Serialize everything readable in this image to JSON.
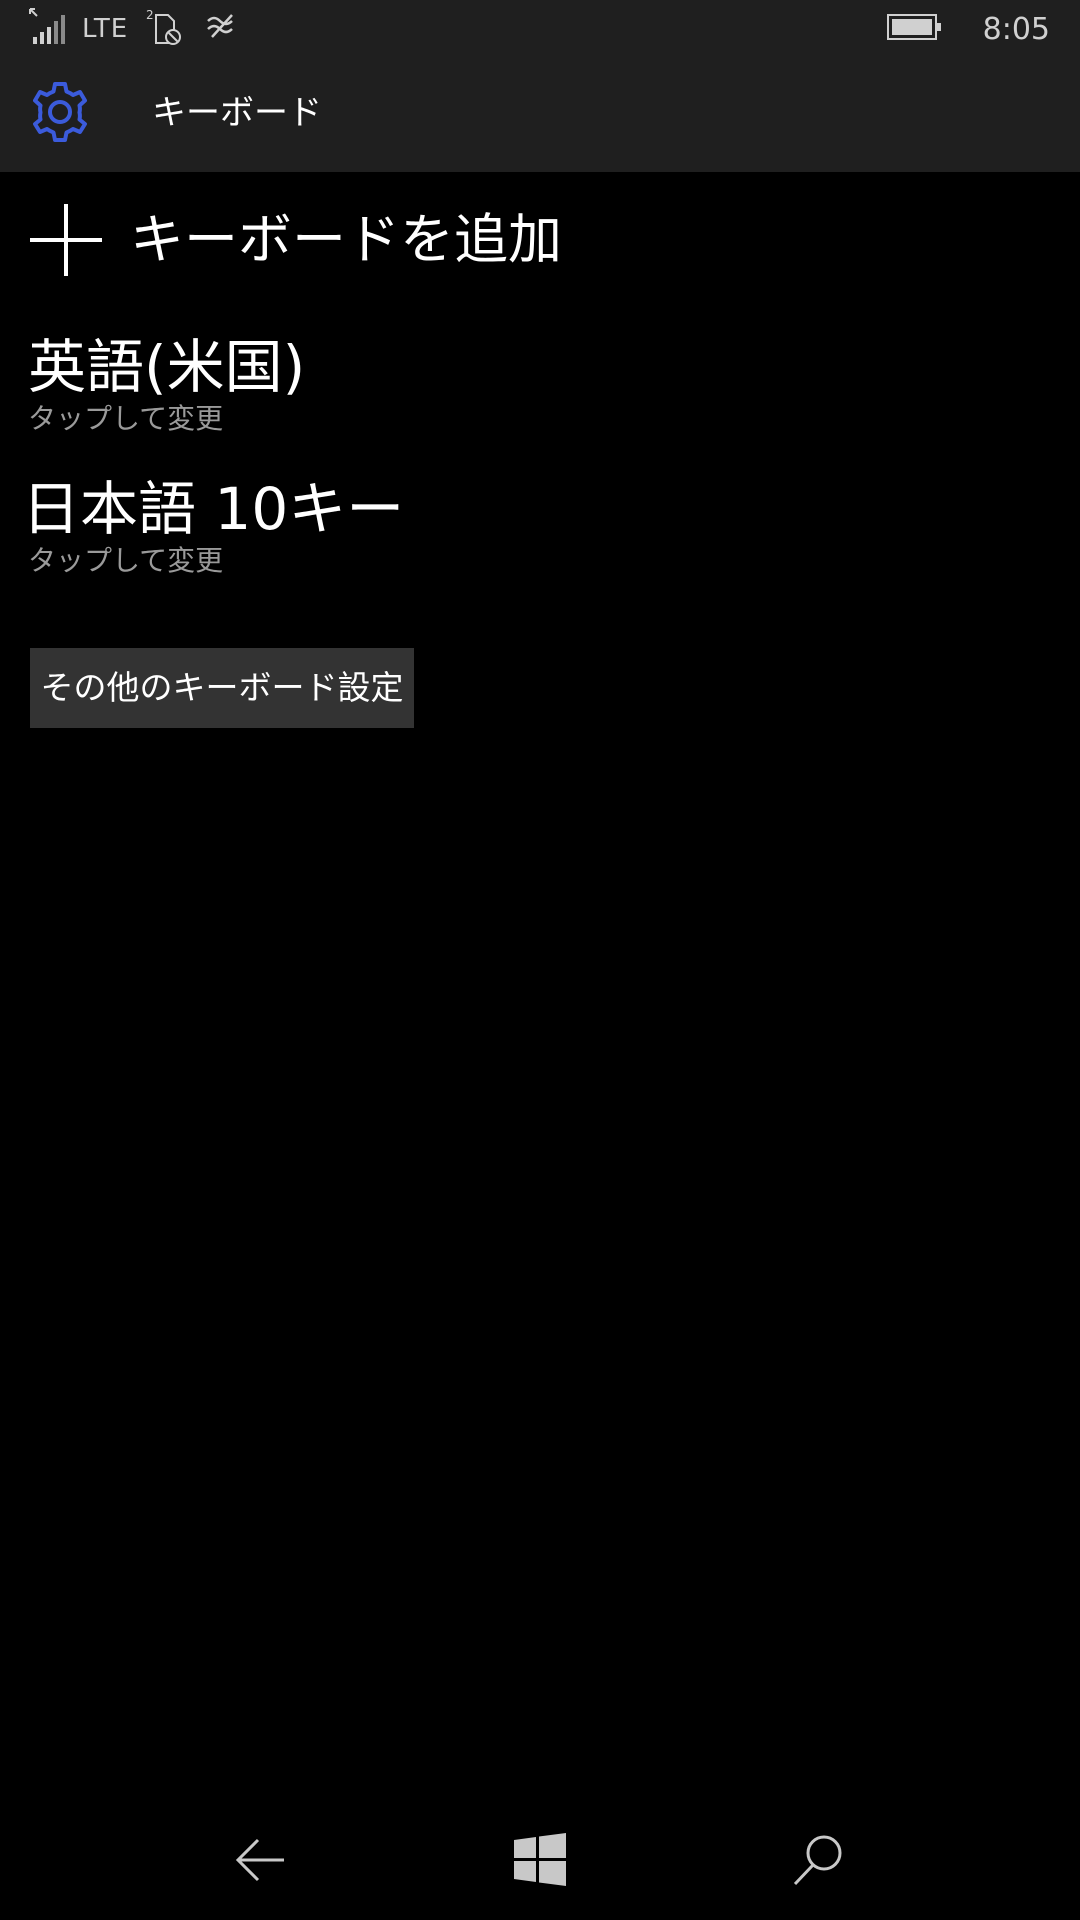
{
  "status_bar": {
    "network": "LTE",
    "sim_badge": "2",
    "time": "8:05",
    "icons": [
      "signal-icon",
      "sim-blocked-icon",
      "wifi-calling-icon",
      "battery-icon"
    ]
  },
  "header": {
    "title": "キーボード",
    "icon": "gear-icon",
    "accent_color": "#3b5bdb"
  },
  "main": {
    "add_keyboard_label": "キーボードを追加",
    "keyboards": [
      {
        "name": "英語(米国)",
        "subtitle": "タップして変更"
      },
      {
        "name": "日本語 10キー",
        "subtitle": "タップして変更"
      }
    ],
    "more_settings_button": "その他のキーボード設定"
  },
  "nav_bar": {
    "buttons": [
      "back-icon",
      "windows-icon",
      "search-icon"
    ]
  }
}
